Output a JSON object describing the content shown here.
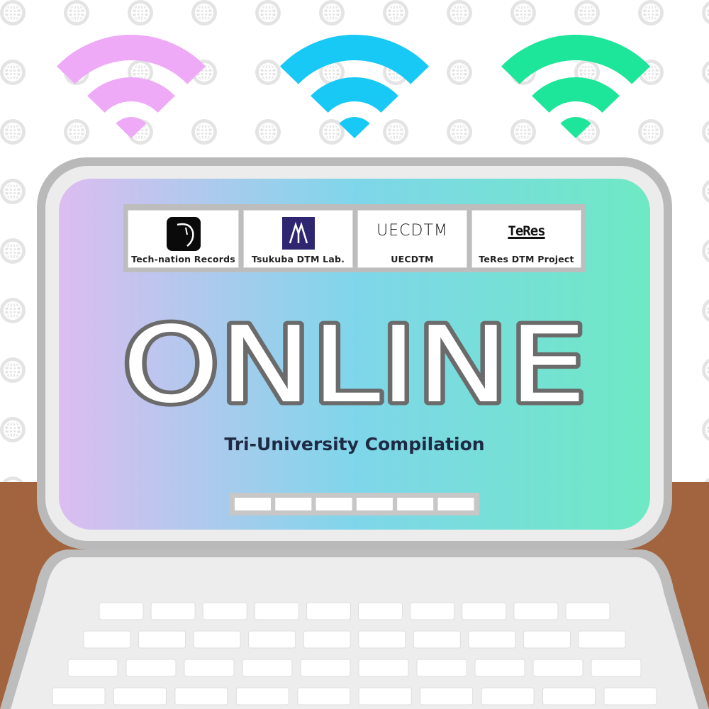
{
  "cover": {
    "title": "ONLINE",
    "subtitle": "Tri-University Compilation",
    "wifi_colors": [
      "#eeaaf7",
      "#18c8f5",
      "#1de59a"
    ],
    "screen_gradient": [
      "#dcbdf0",
      "#7fd6ea",
      "#6ee9c4"
    ]
  },
  "logos": [
    {
      "caption": "Tech-nation Records",
      "icon": "tech-nation-records-logo"
    },
    {
      "caption": "Tsukuba DTM Lab.",
      "icon": "tsukuba-dtm-lab-logo"
    },
    {
      "caption": "UECDTM",
      "icon": "uecdtm-logo",
      "wordmark": "UECDTM"
    },
    {
      "caption": "TeRes DTM Project",
      "icon": "teres-logo",
      "wordmark": "TeRes"
    }
  ]
}
